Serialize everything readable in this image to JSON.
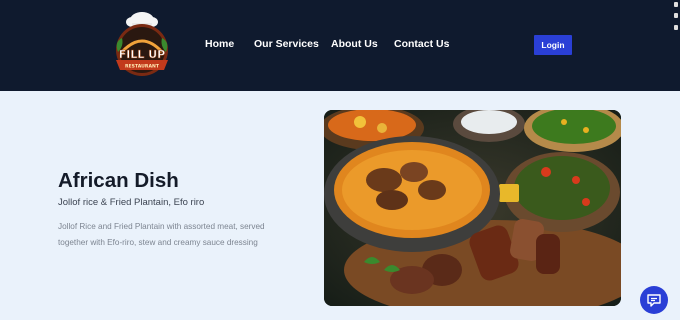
{
  "brand": {
    "logo_text": "FILL UP",
    "logo_subtext": "RESTAURANT"
  },
  "nav": {
    "items": [
      {
        "label": "Home"
      },
      {
        "label": "Our Services"
      },
      {
        "label": "About Us"
      },
      {
        "label": "Contact Us"
      }
    ],
    "login_label": "Login"
  },
  "hero": {
    "title": "African Dish",
    "subtitle": "Jollof rice & Fried Plantain, Efo riro",
    "description": "Jollof Rice and Fried Plantain with assorted meat, served together with Efo-riro, stew and creamy sauce dressing"
  },
  "icons": {
    "chat": "chat-bubble-icon"
  },
  "colors": {
    "header_bg": "#0f1a2e",
    "page_bg": "#eaf2fb",
    "accent": "#2a3fd6"
  }
}
